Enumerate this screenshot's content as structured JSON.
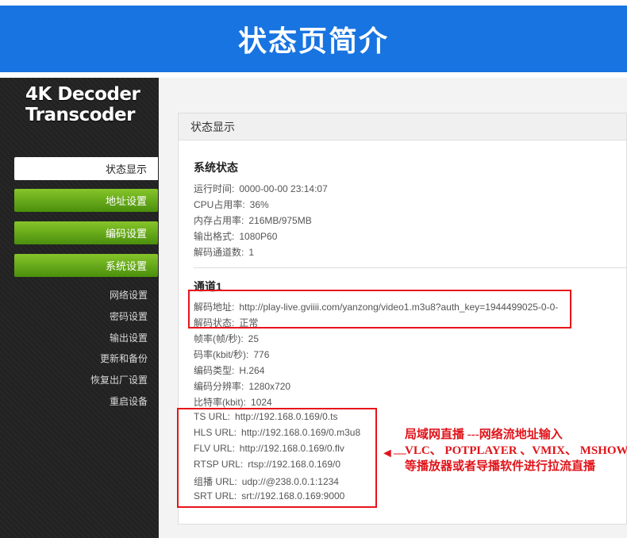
{
  "banner": {
    "title": "状态页简介"
  },
  "logo": {
    "line1": "4K Decoder",
    "line2": "Transcoder"
  },
  "sidebar": {
    "main_items": [
      {
        "label": "状态显示",
        "active": true
      },
      {
        "label": "地址设置",
        "active": false
      },
      {
        "label": "编码设置",
        "active": false
      },
      {
        "label": "系统设置",
        "active": false
      }
    ],
    "sub_items": [
      "网络设置",
      "密码设置",
      "输出设置",
      "更新和备份",
      "恢复出厂设置",
      "重启设备"
    ]
  },
  "panel": {
    "title": "状态显示"
  },
  "system": {
    "title": "系统状态",
    "rows": [
      {
        "label": "运行时间:",
        "value": "0000-00-00 23:14:07"
      },
      {
        "label": "CPU占用率:",
        "value": "36%"
      },
      {
        "label": "内存占用率:",
        "value": "216MB/975MB"
      },
      {
        "label": "输出格式:",
        "value": "1080P60"
      },
      {
        "label": "解码通道数:",
        "value": "1"
      }
    ]
  },
  "channel": {
    "title": "通道1",
    "rows": [
      {
        "label": "解码地址:",
        "value": "http://play-live.gviiii.com/yanzong/video1.m3u8?auth_key=1944499025-0-0-"
      },
      {
        "label": "解码状态:",
        "value": "正常"
      },
      {
        "label": "帧率(帧/秒):",
        "value": "25"
      },
      {
        "label": "码率(kbit/秒):",
        "value": "776"
      },
      {
        "label": "编码类型:",
        "value": "H.264"
      },
      {
        "label": "编码分辨率:",
        "value": "1280x720"
      },
      {
        "label": "比特率(kbit):",
        "value": "1024"
      }
    ],
    "urls": [
      {
        "label": "TS URL:",
        "value": "http://192.168.0.169/0.ts"
      },
      {
        "label": "HLS URL:",
        "value": "http://192.168.0.169/0.m3u8"
      },
      {
        "label": "FLV URL:",
        "value": "http://192.168.0.169/0.flv"
      },
      {
        "label": "RTSP URL:",
        "value": "rtsp://192.168.0.169/0"
      },
      {
        "label": "组播 URL:",
        "value": "udp://@238.0.0.1:1234"
      },
      {
        "label": "SRT URL:",
        "value": "srt://192.168.0.169:9000"
      }
    ]
  },
  "annotation": {
    "lines": [
      "局域网直播 ---网络流地址输入",
      "VLC、 POTPLAYER 、VMIX、 MSHOW",
      "等播放器或者导播软件进行拉流直播"
    ],
    "arrow": "◄—",
    "color": "#e0141a"
  },
  "colors": {
    "banner": "#1874e0",
    "sidebar": "#222222",
    "menu_green": "#5ea612",
    "highlight_red": "#e8141a"
  }
}
